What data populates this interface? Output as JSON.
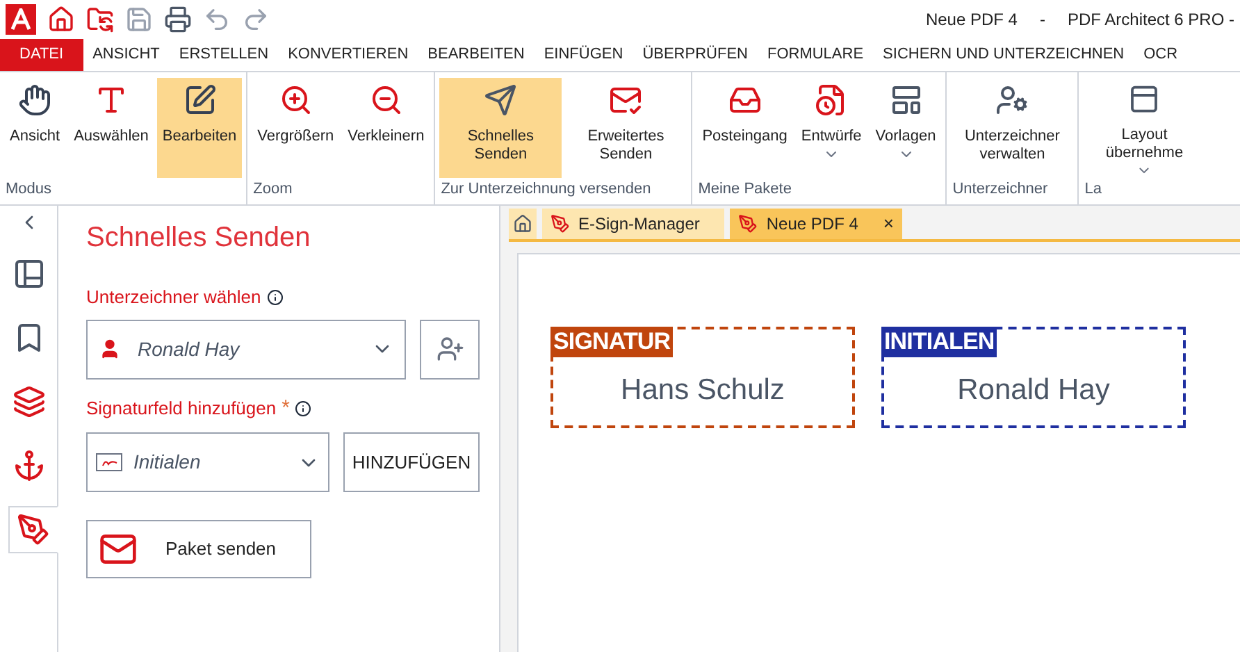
{
  "title_bar": {
    "document": "Neue PDF 4",
    "separator": "-",
    "app": "PDF Architect 6 PRO -"
  },
  "menu_tabs": [
    {
      "label": "DATEI",
      "kind": "file",
      "selected": false
    },
    {
      "label": "ANSICHT",
      "kind": "tab",
      "selected": false
    },
    {
      "label": "ERSTELLEN",
      "kind": "tab",
      "selected": false
    },
    {
      "label": "KONVERTIEREN",
      "kind": "tab",
      "selected": false
    },
    {
      "label": "BEARBEITEN",
      "kind": "tab",
      "selected": false
    },
    {
      "label": "EINFÜGEN",
      "kind": "tab",
      "selected": false
    },
    {
      "label": "ÜBERPRÜFEN",
      "kind": "tab",
      "selected": false
    },
    {
      "label": "FORMULARE",
      "kind": "tab",
      "selected": false
    },
    {
      "label": "SICHERN UND UNTERZEICHNEN",
      "kind": "tab",
      "selected": false
    },
    {
      "label": "OCR",
      "kind": "tab",
      "selected": false
    }
  ],
  "ribbon_groups": [
    {
      "label": "Modus",
      "buttons": [
        {
          "label": "Ansicht",
          "selected": false
        },
        {
          "label": "Auswählen",
          "selected": false
        },
        {
          "label": "Bearbeiten",
          "selected": true
        }
      ]
    },
    {
      "label": "Zoom",
      "buttons": [
        {
          "label": "Vergrößern",
          "selected": false
        },
        {
          "label": "Verkleinern",
          "selected": false
        }
      ]
    },
    {
      "label": "Zur Unterzeichnung versenden",
      "buttons": [
        {
          "label": "Schnelles Senden",
          "selected": true
        },
        {
          "label": "Erweitertes Senden",
          "selected": false
        }
      ]
    },
    {
      "label": "Meine Pakete",
      "buttons": [
        {
          "label": "Posteingang",
          "selected": false,
          "dropdown": false
        },
        {
          "label": "Entwürfe",
          "selected": false,
          "dropdown": true
        },
        {
          "label": "Vorlagen",
          "selected": false,
          "dropdown": true
        }
      ]
    },
    {
      "label": "Unterzeichner",
      "buttons": [
        {
          "label": "Unterzeichner verwalten",
          "selected": false
        }
      ]
    },
    {
      "label": "La",
      "buttons": [
        {
          "label": "Layout übernehme",
          "selected": false,
          "dropdown": true
        }
      ]
    }
  ],
  "side_strip": [
    {
      "selected": false
    },
    {
      "selected": false
    },
    {
      "selected": false
    },
    {
      "selected": false
    },
    {
      "selected": true
    }
  ],
  "panel": {
    "title": "Schnelles Senden",
    "signer_label": "Unterzeichner wählen",
    "signer_value": "Ronald Hay",
    "field_label": "Signaturfeld hinzufügen",
    "required_mark": "*",
    "field_value": "Initialen",
    "add_button": "HINZUFÜGEN",
    "send_button": "Paket senden"
  },
  "doc_tabs": [
    {
      "label": "E-Sign-Manager",
      "selected": false
    },
    {
      "label": "Neue PDF 4",
      "selected": true,
      "close": "×"
    }
  ],
  "signature_fields": [
    {
      "tag": "SIGNATUR",
      "name": "Hans Schulz",
      "color": "#c0450d"
    },
    {
      "tag": "INITIALEN",
      "name": "Ronald Hay",
      "color": "#1f2fa0"
    }
  ]
}
